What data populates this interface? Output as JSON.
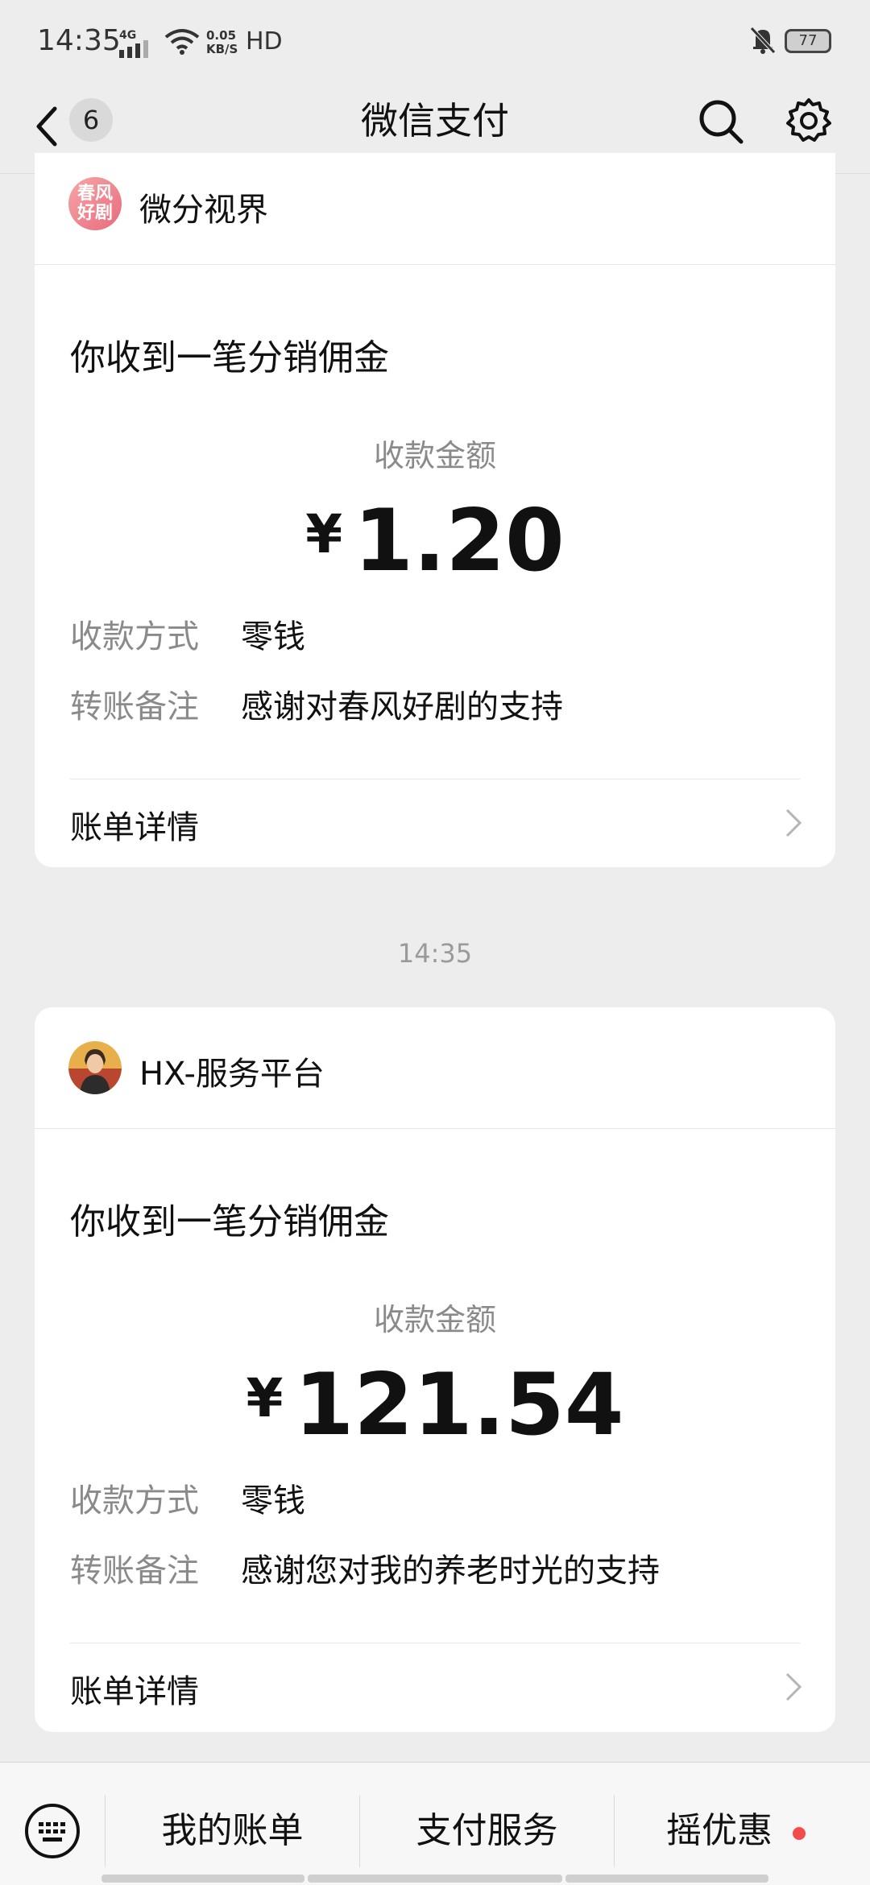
{
  "status_bar": {
    "time": "14:35",
    "network": "4G",
    "speed_value": "0.05",
    "speed_unit": "KB/S",
    "hd": "HD",
    "battery": "77"
  },
  "nav": {
    "unread_count": "6",
    "title": "微信支付"
  },
  "messages": [
    {
      "merchant_name": "微分视界",
      "avatar_text": [
        "春风",
        "好剧"
      ],
      "title": "你收到一笔分销佣金",
      "amount_label": "收款金额",
      "currency_symbol": "¥",
      "amount": "1.20",
      "payment_method_label": "收款方式",
      "payment_method": "零钱",
      "remark_label": "转账备注",
      "remark": "感谢对春风好剧的支持",
      "detail_link": "账单详情"
    },
    {
      "timestamp": "14:35",
      "merchant_name": "HX-服务平台",
      "title": "你收到一笔分销佣金",
      "amount_label": "收款金额",
      "currency_symbol": "¥",
      "amount": "121.54",
      "payment_method_label": "收款方式",
      "payment_method": "零钱",
      "remark_label": "转账备注",
      "remark": "感谢您对我的养老时光的支持",
      "detail_link": "账单详情"
    }
  ],
  "bottom_menu": {
    "items": [
      "我的账单",
      "支付服务",
      "摇优惠"
    ]
  },
  "colors": {
    "background": "#ededed",
    "card": "#ffffff",
    "secondary_text": "#8a8a8a",
    "notification_dot": "#f44c4c"
  }
}
